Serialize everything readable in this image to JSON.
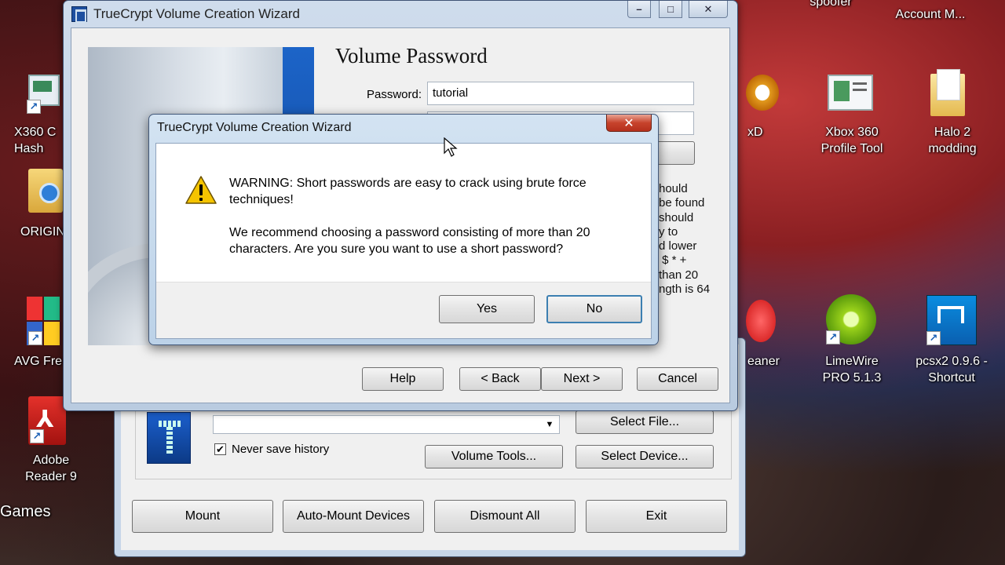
{
  "desktop": {
    "icons": [
      {
        "label": "X360 C\nHash"
      },
      {
        "label": "ORIGIN"
      },
      {
        "label": "AVG Fre"
      },
      {
        "label": "Adobe\nReader 9"
      },
      {
        "label": "Games"
      },
      {
        "label": "xD"
      },
      {
        "label": "Xbox 360\nProfile Tool"
      },
      {
        "label": "Halo 2\nmodding"
      },
      {
        "label": "eaner"
      },
      {
        "label": "LimeWire\nPRO 5.1.3"
      },
      {
        "label": "pcsx2 0.9.6 -\nShortcut"
      },
      {
        "label": "spoofer"
      },
      {
        "label": "Account M..."
      }
    ]
  },
  "main_window": {
    "never_save_history_label": "Never save history",
    "never_save_history_checked": true,
    "buttons": {
      "select_file": "Select File...",
      "volume_tools": "Volume Tools...",
      "select_device": "Select Device...",
      "mount": "Mount",
      "auto_mount": "Auto-Mount Devices",
      "dismount_all": "Dismount All",
      "exit": "Exit"
    }
  },
  "wizard": {
    "title": "TrueCrypt Volume Creation Wizard",
    "heading": "Volume Password",
    "password_label": "Password:",
    "password_value": "tutorial",
    "info_text": "hould\nbe found\nshould\ny to\nd lower\n $ * +\nthan 20\nngth is 64",
    "buttons": {
      "help": "Help",
      "back": "< Back",
      "next": "Next >",
      "cancel": "Cancel"
    },
    "controls": {
      "minimize": "–",
      "maximize": "□",
      "close": "✕"
    }
  },
  "dialog": {
    "title": "TrueCrypt Volume Creation Wizard",
    "close": "✕",
    "message_1": "WARNING: Short passwords are easy to crack using brute force techniques!",
    "message_2": "We recommend choosing a password consisting of more than 20 characters. Are you sure you want to use a short password?",
    "yes": "Yes",
    "no": "No"
  },
  "colors": {
    "warning_yellow": "#f5c400",
    "accent_blue": "#1c64c8"
  }
}
